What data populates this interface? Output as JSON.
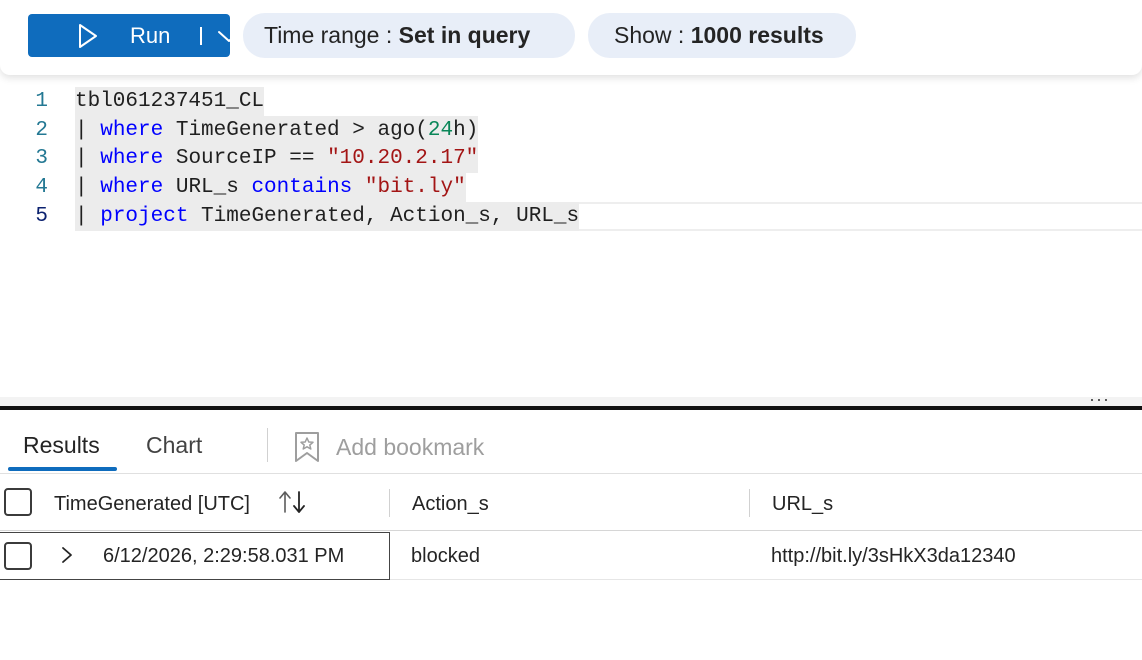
{
  "toolbar": {
    "run_label": "Run",
    "time_range": {
      "label": "Time range : ",
      "value": "Set in query"
    },
    "show": {
      "label": "Show : ",
      "value": "1000 results"
    },
    "accent_color": "#0f6cbd",
    "icons": [
      "play-icon",
      "chevron-down-icon"
    ]
  },
  "editor": {
    "active_line": 5,
    "lines": [
      {
        "num": "1",
        "segments": [
          {
            "t": "tbl061237451_CL",
            "k": "plain"
          }
        ]
      },
      {
        "num": "2",
        "segments": [
          {
            "t": "| ",
            "k": "plain"
          },
          {
            "t": "where",
            "k": "kw"
          },
          {
            "t": " TimeGenerated > ago(",
            "k": "plain"
          },
          {
            "t": "24",
            "k": "numlit"
          },
          {
            "t": "h)",
            "k": "plain"
          }
        ]
      },
      {
        "num": "3",
        "segments": [
          {
            "t": "| ",
            "k": "plain"
          },
          {
            "t": "where",
            "k": "kw"
          },
          {
            "t": " SourceIP == ",
            "k": "plain"
          },
          {
            "t": "\"10.20.2.17\"",
            "k": "str"
          }
        ]
      },
      {
        "num": "4",
        "segments": [
          {
            "t": "| ",
            "k": "plain"
          },
          {
            "t": "where",
            "k": "kw"
          },
          {
            "t": " URL_s ",
            "k": "plain"
          },
          {
            "t": "contains",
            "k": "kw"
          },
          {
            "t": " ",
            "k": "plain"
          },
          {
            "t": "\"bit.ly\"",
            "k": "str"
          }
        ]
      },
      {
        "num": "5",
        "segments": [
          {
            "t": "| ",
            "k": "plain"
          },
          {
            "t": "project",
            "k": "kw"
          },
          {
            "t": " TimeGenerated, Action_s, URL_s",
            "k": "plain"
          }
        ]
      }
    ]
  },
  "results": {
    "tabs": {
      "results": "Results",
      "chart": "Chart",
      "active": "Results"
    },
    "add_bookmark": "Add bookmark",
    "columns": {
      "time": "TimeGenerated [UTC]",
      "action": "Action_s",
      "url": "URL_s"
    },
    "rows": [
      {
        "time": "6/12/2026, 2:29:58.031 PM",
        "action": "blocked",
        "url": "http://bit.ly/3sHkX3da12340"
      }
    ]
  }
}
